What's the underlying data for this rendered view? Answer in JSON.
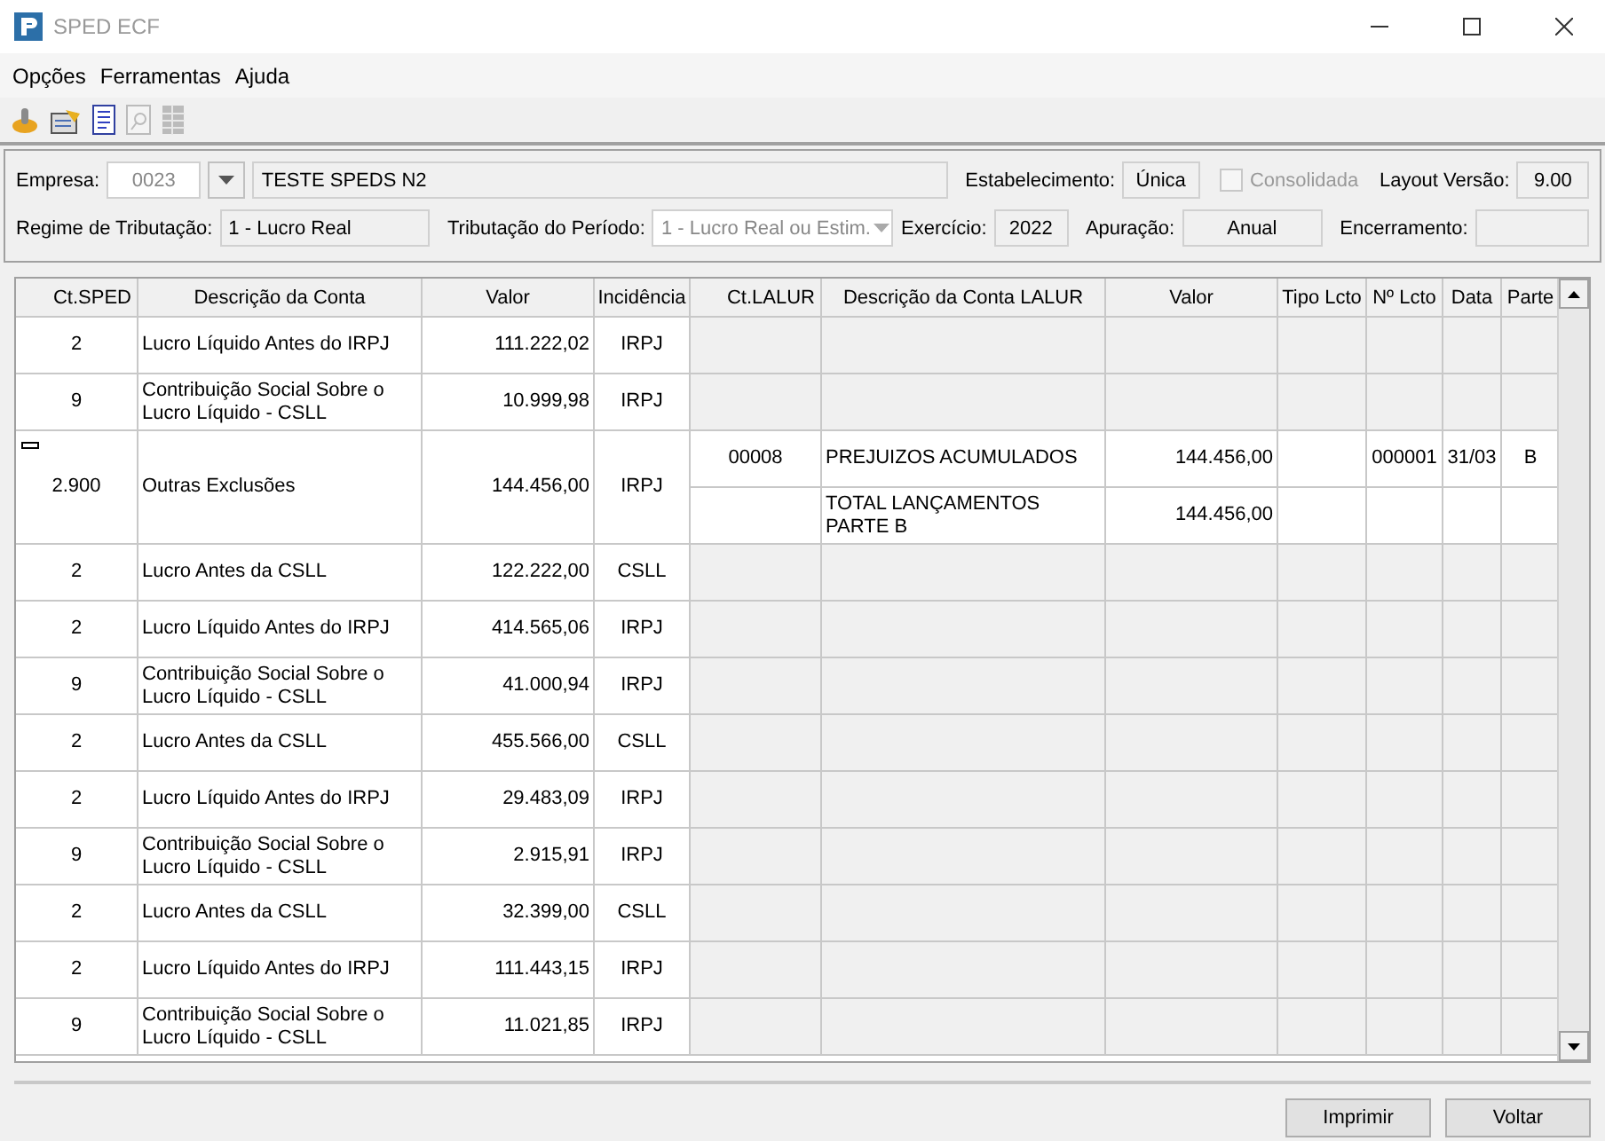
{
  "window": {
    "title": "SPED ECF"
  },
  "menu": [
    "Opções",
    "Ferramentas",
    "Ajuda"
  ],
  "toolbar": [
    {
      "kind": "coin",
      "disabled": false
    },
    {
      "kind": "folder",
      "disabled": false
    },
    {
      "kind": "document",
      "disabled": false
    },
    {
      "kind": "preview",
      "disabled": true
    },
    {
      "kind": "grid",
      "disabled": true
    }
  ],
  "header": {
    "empresa_label": "Empresa:",
    "empresa_code": "0023",
    "empresa_name": "TESTE SPEDS N2",
    "estabelecimento_label": "Estabelecimento:",
    "estabelecimento": "Única",
    "consolidada": {
      "label": "Consolidada",
      "checked": false,
      "disabled": true
    },
    "layout_label": "Layout Versão:",
    "layout": "9.00",
    "regime_label": "Regime de Tributação:",
    "regime": "1 - Lucro Real",
    "periodo_label": "Tributação do Período:",
    "periodo": "1 - Lucro Real ou Estim.",
    "exercicio_label": "Exercício:",
    "exercicio": "2022",
    "apuracao_label": "Apuração:",
    "apuracao": "Anual",
    "encerramento_label": "Encerramento:"
  },
  "table": {
    "columns": [
      "Ct.SPED",
      "Descrição da Conta",
      "Valor",
      "Incidência",
      "Ct.LALUR",
      "Descrição da Conta LALUR",
      "Valor",
      "Tipo Lcto",
      "Nº Lcto",
      "Data",
      "Parte"
    ],
    "rows": [
      {
        "ct": "2",
        "desc": "Lucro Líquido Antes do IRPJ",
        "valor": "111.222,02",
        "inc": "IRPJ",
        "expanded": false
      },
      {
        "ct": "9",
        "desc": "Contribuição Social Sobre o Lucro Líquido - CSLL",
        "valor": "10.999,98",
        "inc": "IRPJ",
        "expanded": false
      },
      {
        "ct": "2.900",
        "desc": "Outras Exclusões",
        "valor": "144.456,00",
        "inc": "IRPJ",
        "expanded": true,
        "lalur": [
          {
            "ct": "00008",
            "desc": "PREJUIZOS ACUMULADOS",
            "valor": "144.456,00",
            "num": "000001",
            "data": "31/03",
            "parte": "B"
          },
          {
            "desc": "TOTAL LANÇAMENTOS PARTE B",
            "valor": "144.456,00"
          }
        ]
      },
      {
        "ct": "2",
        "desc": "Lucro Antes da CSLL",
        "valor": "122.222,00",
        "inc": "CSLL",
        "expanded": false
      },
      {
        "ct": "2",
        "desc": "Lucro Líquido Antes do IRPJ",
        "valor": "414.565,06",
        "inc": "IRPJ",
        "expanded": false
      },
      {
        "ct": "9",
        "desc": "Contribuição Social Sobre o Lucro Líquido - CSLL",
        "valor": "41.000,94",
        "inc": "IRPJ",
        "expanded": false
      },
      {
        "ct": "2",
        "desc": "Lucro Antes da CSLL",
        "valor": "455.566,00",
        "inc": "CSLL",
        "expanded": false
      },
      {
        "ct": "2",
        "desc": "Lucro Líquido Antes do IRPJ",
        "valor": "29.483,09",
        "inc": "IRPJ",
        "expanded": false
      },
      {
        "ct": "9",
        "desc": "Contribuição Social Sobre o Lucro Líquido - CSLL",
        "valor": "2.915,91",
        "inc": "IRPJ",
        "expanded": false
      },
      {
        "ct": "2",
        "desc": "Lucro Antes da CSLL",
        "valor": "32.399,00",
        "inc": "CSLL",
        "expanded": false
      },
      {
        "ct": "2",
        "desc": "Lucro Líquido Antes do IRPJ",
        "valor": "111.443,15",
        "inc": "IRPJ",
        "expanded": false
      },
      {
        "ct": "9",
        "desc": "Contribuição Social Sobre o Lucro Líquido - CSLL",
        "valor": "11.021,85",
        "inc": "IRPJ",
        "expanded": false
      }
    ]
  },
  "buttons": [
    "Imprimir",
    "Voltar"
  ]
}
